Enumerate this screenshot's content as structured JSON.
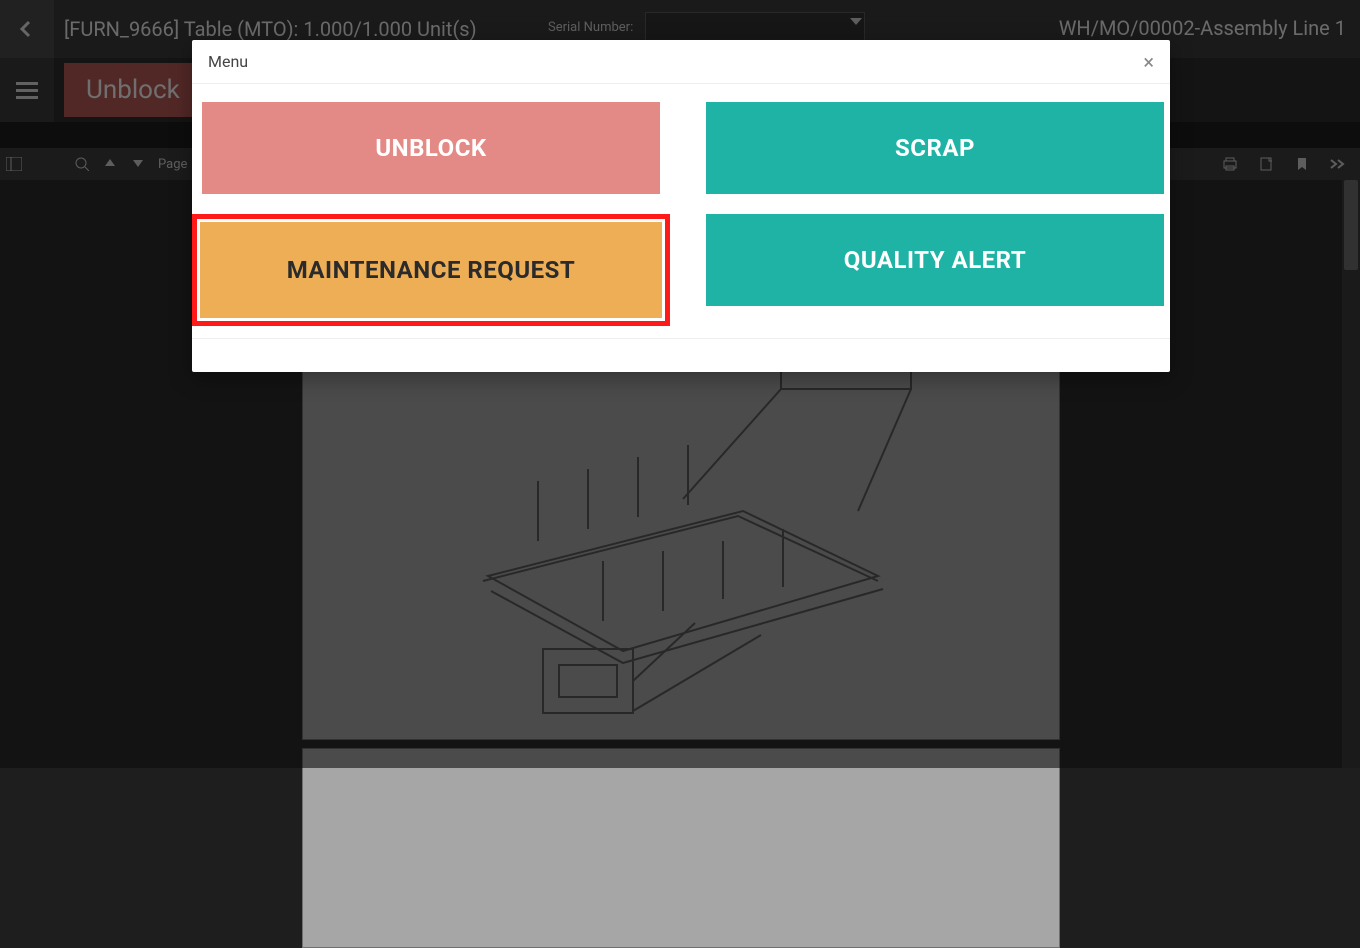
{
  "header": {
    "title": "[FURN_9666] Table (MTO): 1.000/1.000 Unit(s)",
    "serial_label": "Serial Number:",
    "right_title": "WH/MO/00002-Assembly Line 1"
  },
  "bar2": {
    "unblock_label": "Unblock"
  },
  "pdfbar": {
    "page_label": "Page"
  },
  "modal": {
    "title": "Menu",
    "close": "×",
    "buttons": {
      "unblock": "UNBLOCK",
      "scrap": "SCRAP",
      "maintenance": "MAINTENANCE REQUEST",
      "quality": "QUALITY ALERT"
    }
  }
}
